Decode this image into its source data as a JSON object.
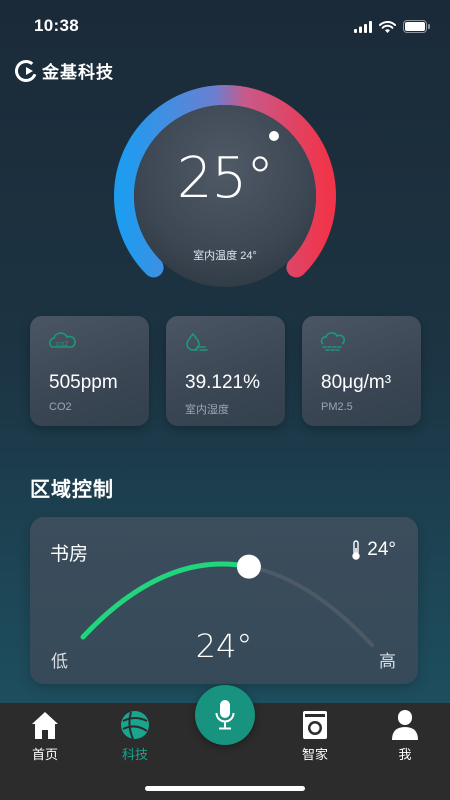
{
  "status_bar": {
    "time": "10:38"
  },
  "brand": {
    "name": "金基科技"
  },
  "thermostat": {
    "temperature": "25°",
    "indoor_label": "室内温度 24°"
  },
  "metrics": [
    {
      "value": "505ppm",
      "label": "CO2",
      "icon": "co2-icon"
    },
    {
      "value": "39.121%",
      "label": "室内湿度",
      "icon": "humidity-icon"
    },
    {
      "value": "80μg/m³",
      "label": "PM2.5",
      "icon": "pm25-icon"
    }
  ],
  "zone_control": {
    "title": "区域控制",
    "room": {
      "name": "书房",
      "current_temp": "24°",
      "set_temp": "24°",
      "low_label": "低",
      "high_label": "高",
      "slider_fraction": 0.58
    }
  },
  "tabbar": {
    "tabs": [
      {
        "label": "首页",
        "icon": "home-icon",
        "active": false
      },
      {
        "label": "科技",
        "icon": "tech-icon",
        "active": true
      },
      {
        "label": "智家",
        "icon": "smart-home-icon",
        "active": false
      },
      {
        "label": "我",
        "icon": "profile-icon",
        "active": false
      }
    ],
    "mic_icon": "microphone-icon"
  },
  "colors": {
    "accent": "#17937f",
    "cold": "#1e9cf0",
    "hot": "#f0354a",
    "slider": "#22d47b"
  }
}
